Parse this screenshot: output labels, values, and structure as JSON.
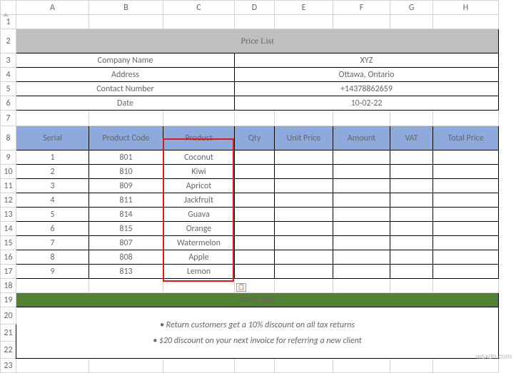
{
  "columns": [
    "A",
    "B",
    "C",
    "D",
    "E",
    "F",
    "G",
    "H"
  ],
  "row_nums": [
    1,
    2,
    3,
    4,
    5,
    6,
    7,
    8,
    9,
    10,
    11,
    12,
    13,
    14,
    15,
    16,
    17,
    18,
    19,
    20,
    21,
    22,
    23
  ],
  "title": "Price List",
  "info": {
    "company_label": "Company Name",
    "company_value": "XYZ",
    "address_label": "Address",
    "address_value": "Ottawa, Ontario",
    "contact_label": "Contact Number",
    "contact_value": "+14378862659",
    "date_label": "Date",
    "date_value": "10-02-22"
  },
  "headers": {
    "serial": "Serial",
    "code": "Product Code",
    "product": "Product",
    "qty": "Qty",
    "unit": "Unit Price",
    "amount": "Amount",
    "vat": "VAT",
    "total": "Total Price"
  },
  "rows": [
    {
      "serial": "1",
      "code": "801",
      "product": "Coconut"
    },
    {
      "serial": "2",
      "code": "810",
      "product": "Kiwi"
    },
    {
      "serial": "3",
      "code": "809",
      "product": "Apricot"
    },
    {
      "serial": "4",
      "code": "811",
      "product": "Jackfruit"
    },
    {
      "serial": "5",
      "code": "814",
      "product": "Guava"
    },
    {
      "serial": "6",
      "code": "815",
      "product": "Orange"
    },
    {
      "serial": "7",
      "code": "807",
      "product": "Watermelon"
    },
    {
      "serial": "8",
      "code": "808",
      "product": "Apple"
    },
    {
      "serial": "9",
      "code": "813",
      "product": "Lemon"
    }
  ],
  "discounts": {
    "header": "Discounts",
    "line1": "• Return customers get a 10% discount on all tax returns",
    "line2": "• $20 discount on your next invoice for referring a new client"
  },
  "watermark": "wsxdn.com",
  "chart_data": {
    "type": "table",
    "title": "Price List",
    "columns": [
      "Serial",
      "Product Code",
      "Product",
      "Qty",
      "Unit Price",
      "Amount",
      "VAT",
      "Total Price"
    ],
    "rows": [
      [
        1,
        801,
        "Coconut",
        null,
        null,
        null,
        null,
        null
      ],
      [
        2,
        810,
        "Kiwi",
        null,
        null,
        null,
        null,
        null
      ],
      [
        3,
        809,
        "Apricot",
        null,
        null,
        null,
        null,
        null
      ],
      [
        4,
        811,
        "Jackfruit",
        null,
        null,
        null,
        null,
        null
      ],
      [
        5,
        814,
        "Guava",
        null,
        null,
        null,
        null,
        null
      ],
      [
        6,
        815,
        "Orange",
        null,
        null,
        null,
        null,
        null
      ],
      [
        7,
        807,
        "Watermelon",
        null,
        null,
        null,
        null,
        null
      ],
      [
        8,
        808,
        "Apple",
        null,
        null,
        null,
        null,
        null
      ],
      [
        9,
        813,
        "Lemon",
        null,
        null,
        null,
        null,
        null
      ]
    ]
  }
}
